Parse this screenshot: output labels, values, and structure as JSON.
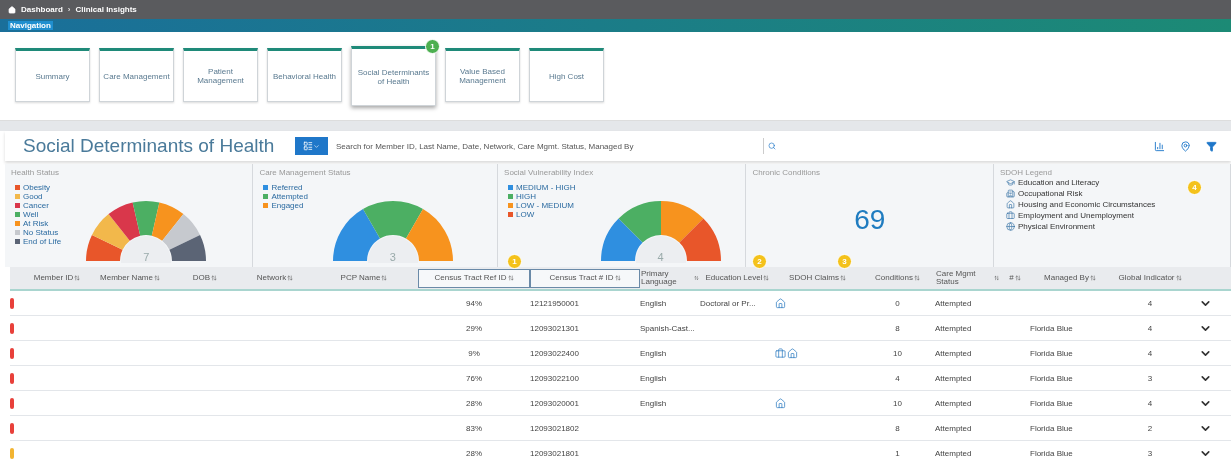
{
  "breadcrumb": {
    "home": "Dashboard",
    "separator": "›",
    "current": "Clinical Insights"
  },
  "navigation": {
    "label": "Navigation",
    "tiles": [
      {
        "label": "Summary",
        "selected": false
      },
      {
        "label": "Care Management",
        "selected": false
      },
      {
        "label": "Patient Management",
        "selected": false
      },
      {
        "label": "Behavioral Health",
        "selected": false
      },
      {
        "label": "Social Determinants of Health",
        "selected": true,
        "marker": "1"
      },
      {
        "label": "Value Based Management",
        "selected": false
      },
      {
        "label": "High Cost",
        "selected": false
      }
    ]
  },
  "page": {
    "title": "Social Determinants of Health",
    "search": {
      "placeholder": "Search for Member ID, Last Name, Date, Network, Care Mgmt. Status, Managed By"
    }
  },
  "cards": [
    {
      "kind": "gauge",
      "title": "Health Status",
      "center": "7",
      "legend": [
        {
          "label": "Obesity",
          "color": "#e8562a"
        },
        {
          "label": "Good",
          "color": "#f2b84b"
        },
        {
          "label": "Cancer",
          "color": "#d9374b"
        },
        {
          "label": "Well",
          "color": "#4caf63"
        },
        {
          "label": "At Risk",
          "color": "#f7931e"
        },
        {
          "label": "No Status",
          "color": "#c6c9ce"
        },
        {
          "label": "End of Life",
          "color": "#5b6475"
        }
      ]
    },
    {
      "kind": "gauge",
      "title": "Care Management Status",
      "center": "3",
      "legend": [
        {
          "label": "Referred",
          "color": "#2f8fe0"
        },
        {
          "label": "Attempted",
          "color": "#4caf63"
        },
        {
          "label": "Engaged",
          "color": "#f7931e"
        }
      ]
    },
    {
      "kind": "gauge",
      "title": "Social Vulnerability Index",
      "center": "4",
      "legend": [
        {
          "label": "MEDIUM - HIGH",
          "color": "#2f8fe0"
        },
        {
          "label": "HIGH",
          "color": "#4caf63"
        },
        {
          "label": "LOW - MEDIUM",
          "color": "#f7931e"
        },
        {
          "label": "LOW",
          "color": "#e8562a"
        }
      ]
    },
    {
      "kind": "number",
      "title": "Chronic Conditions",
      "value": "69"
    },
    {
      "kind": "legend",
      "title": "SDOH Legend",
      "marker": "4",
      "items": [
        {
          "label": "Education and Literacy",
          "kind": "education"
        },
        {
          "label": "Occupational Risk",
          "kind": "occupational"
        },
        {
          "label": "Housing and Economic Circumstances",
          "kind": "housing"
        },
        {
          "label": "Employment and Unemployment",
          "kind": "employment"
        },
        {
          "label": "Physical Environment",
          "kind": "environment"
        }
      ]
    }
  ],
  "table": {
    "columns": [
      {
        "label": "Member ID",
        "highlighted": false
      },
      {
        "label": "Member Name",
        "highlighted": false
      },
      {
        "label": "DOB",
        "highlighted": false
      },
      {
        "label": "Network",
        "highlighted": false
      },
      {
        "label": "PCP Name",
        "highlighted": false
      },
      {
        "label": "Census Tract Ref ID",
        "highlighted": true,
        "marker": "1"
      },
      {
        "label": "Census Tract # ID",
        "highlighted": true
      },
      {
        "label": "Primary Language",
        "highlighted": false
      },
      {
        "label": "Education Level",
        "highlighted": false,
        "marker": "2"
      },
      {
        "label": "SDOH Claims",
        "highlighted": false,
        "marker": "3"
      },
      {
        "label": "Conditions",
        "highlighted": false
      },
      {
        "label": "Care Mgmt Status",
        "highlighted": false
      },
      {
        "label": "#",
        "highlighted": false
      },
      {
        "label": "Managed By",
        "highlighted": false
      },
      {
        "label": "Global Indicator",
        "highlighted": false
      }
    ],
    "rows": [
      {
        "color": "#e8403a",
        "census": "94%",
        "tract": "12121950001",
        "language": "English",
        "education": "Doctoral or Pr...",
        "sdoh": [
          {
            "kind": "housing"
          }
        ],
        "conditions": "0",
        "status": "Attempted",
        "managed_by": "",
        "indicator": "4"
      },
      {
        "color": "#e8403a",
        "census": "29%",
        "tract": "12093021301",
        "language": "Spanish-Cast...",
        "education": "",
        "sdoh": [],
        "conditions": "8",
        "status": "Attempted",
        "managed_by": "Florida Blue",
        "indicator": "4"
      },
      {
        "color": "#e8403a",
        "census": "9%",
        "tract": "12093022400",
        "language": "English",
        "education": "",
        "sdoh": [
          {
            "kind": "employment"
          },
          {
            "kind": "housing"
          }
        ],
        "conditions": "10",
        "status": "Attempted",
        "managed_by": "Florida Blue",
        "indicator": "4"
      },
      {
        "color": "#e8403a",
        "census": "76%",
        "tract": "12093022100",
        "language": "English",
        "education": "",
        "sdoh": [],
        "conditions": "4",
        "status": "Attempted",
        "managed_by": "Florida Blue",
        "indicator": "3"
      },
      {
        "color": "#e8403a",
        "census": "28%",
        "tract": "12093020001",
        "language": "English",
        "education": "",
        "sdoh": [
          {
            "kind": "housing"
          }
        ],
        "conditions": "10",
        "status": "Attempted",
        "managed_by": "Florida Blue",
        "indicator": "4"
      },
      {
        "color": "#e8403a",
        "census": "83%",
        "tract": "12093021802",
        "language": "",
        "education": "",
        "sdoh": [],
        "conditions": "8",
        "status": "Attempted",
        "managed_by": "Florida Blue",
        "indicator": "2"
      },
      {
        "color": "#f2b431",
        "census": "28%",
        "tract": "12093021801",
        "language": "",
        "education": "",
        "sdoh": [],
        "conditions": "1",
        "status": "Attempted",
        "managed_by": "Florida Blue",
        "indicator": "3"
      }
    ]
  }
}
